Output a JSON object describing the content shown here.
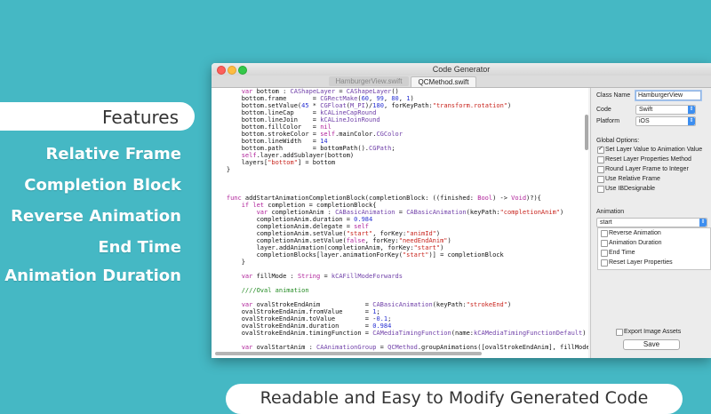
{
  "features": {
    "heading": "Features",
    "items": [
      "Relative Frame",
      "Completion Block",
      "Reverse Animation",
      "End Time",
      "Animation Duration"
    ]
  },
  "caption": "Readable and Easy to Modify Generated Code",
  "window": {
    "title": "Code Generator",
    "tabs": [
      "HamburgerView.swift",
      "QCMethod.swift"
    ],
    "active_tab": "QCMethod.swift"
  },
  "code_lines": [
    "        var bottom : CAShapeLayer = CAShapeLayer()",
    "        bottom.frame       = CGRectMake(60, 99, 80, 1)",
    "        bottom.setValue(45 * CGFloat(M_PI)/180, forKeyPath:\"transform.rotation\")",
    "        bottom.lineCap     = kCALineCapRound",
    "        bottom.lineJoin    = kCALineJoinRound",
    "        bottom.fillColor   = nil",
    "        bottom.strokeColor = self.mainColor.CGColor",
    "        bottom.lineWidth   = 14",
    "        bottom.path        = bottomPath().CGPath;",
    "        self.layer.addSublayer(bottom)",
    "        layers[\"bottom\"] = bottom",
    "    }",
    "",
    "",
    "",
    "    func addStartAnimationCompletionBlock(completionBlock: ((finished: Bool) -> Void)?){",
    "        if let completion = completionBlock{",
    "            var completionAnim : CABasicAnimation = CABasicAnimation(keyPath:\"completionAnim\")",
    "            completionAnim.duration = 0.984",
    "            completionAnim.delegate = self",
    "            completionAnim.setValue(\"start\", forKey:\"animId\")",
    "            completionAnim.setValue(false, forKey:\"needEndAnim\")",
    "            layer.addAnimation(completionAnim, forKey:\"start\")",
    "            completionBlocks[layer.animationForKey(\"start\")] = completionBlock",
    "        }",
    "",
    "        var fillMode : String = kCAFillModeForwards",
    "",
    "        ////Oval animation",
    "",
    "        var ovalStrokeEndAnim            = CABasicAnimation(keyPath:\"strokeEnd\")",
    "        ovalStrokeEndAnim.fromValue      = 1;",
    "        ovalStrokeEndAnim.toValue        = -0.1;",
    "        ovalStrokeEndAnim.duration       = 0.984",
    "        ovalStrokeEndAnim.timingFunction = CAMediaTimingFunction(name:kCAMediaTimingFunctionDefault)",
    "",
    "        var ovalStartAnim : CAAnimationGroup = QCMethod.groupAnimations([ovalStrokeEndAnim], fillMode:"
  ],
  "panel": {
    "class_name_label": "Class Name",
    "class_name_value": "HamburgerView",
    "code_label": "Code",
    "code_value": "Swift",
    "platform_label": "Platform",
    "platform_value": "iOS",
    "global_options_label": "Global Options:",
    "global_options": [
      {
        "label": "Set Layer Value to Animation Value",
        "checked": true
      },
      {
        "label": "Reset Layer Properties Method",
        "checked": false
      },
      {
        "label": "Round Layer Frame to Integer",
        "checked": false
      },
      {
        "label": "Use Relative Frame",
        "checked": false
      },
      {
        "label": "Use IBDesignable",
        "checked": false
      }
    ],
    "animation_label": "Animation",
    "animation_value": "start",
    "animation_options": [
      {
        "label": "Reverse Animation",
        "checked": false
      },
      {
        "label": "Animation Duration",
        "checked": false
      },
      {
        "label": "End Time",
        "checked": false
      },
      {
        "label": "Reset Layer Properties",
        "checked": false
      }
    ],
    "export_label": "Export Image Assets",
    "export_checked": false,
    "save_label": "Save"
  },
  "colors": {
    "background": "#45b8c4",
    "keyword": "#b0229a",
    "type": "#6f3fa8",
    "string": "#c8241d",
    "number": "#2730d2",
    "comment": "#228a22"
  }
}
